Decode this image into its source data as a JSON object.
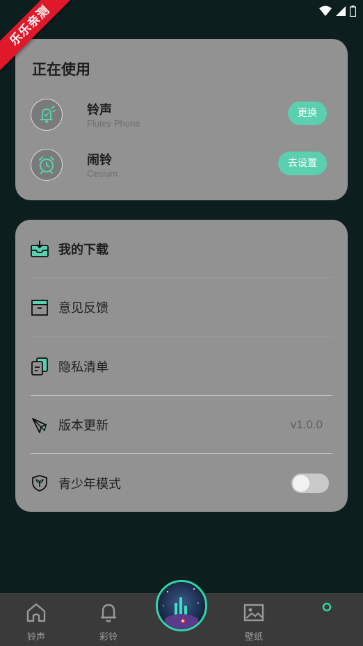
{
  "watermark": "乐乐亲测",
  "now_using": {
    "title": "正在使用",
    "items": [
      {
        "title": "铃声",
        "subtitle": "Flutey Phone",
        "button": "更换"
      },
      {
        "title": "闹铃",
        "subtitle": "Cesium",
        "button": "去设置"
      }
    ]
  },
  "menu": {
    "items": [
      {
        "label": "我的下载"
      },
      {
        "label": "意见反馈"
      },
      {
        "label": "隐私清单"
      },
      {
        "label": "版本更新",
        "value": "v1.0.0"
      },
      {
        "label": "青少年模式",
        "toggle": false
      }
    ]
  },
  "tabbar": {
    "tabs": [
      {
        "label": "铃声",
        "icon": "home-icon"
      },
      {
        "label": "彩铃",
        "icon": "bell-icon"
      },
      {
        "label": "",
        "icon": "center-player-art"
      },
      {
        "label": "壁纸",
        "icon": "image-icon"
      },
      {
        "label": "",
        "icon": "profile-dot-icon"
      }
    ]
  },
  "colors": {
    "accent": "#5bd0b0",
    "background": "#0c1e1e",
    "card": "#929292",
    "tabbar": "#3a3a3a"
  }
}
